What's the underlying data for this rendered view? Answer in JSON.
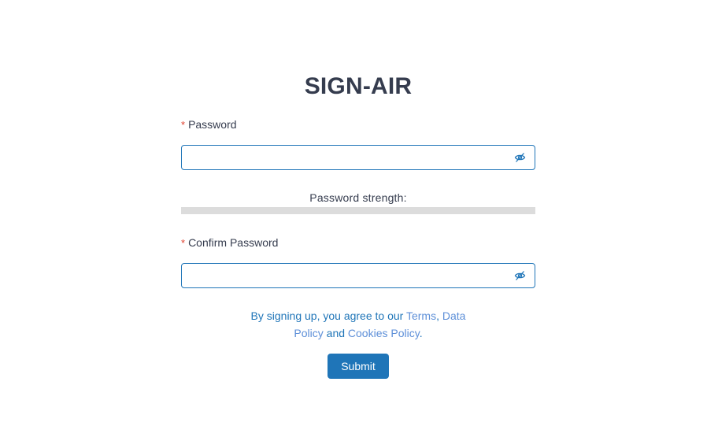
{
  "form": {
    "title": "SIGN-AIR",
    "required_mark": "*",
    "password": {
      "label": "Password",
      "value": "",
      "placeholder": ""
    },
    "strength": {
      "label": "Password strength:",
      "level": 0
    },
    "confirm": {
      "label": "Confirm Password",
      "value": "",
      "placeholder": ""
    },
    "terms": {
      "prefix": "By signing up, you agree to our ",
      "terms_link": "Terms",
      "sep": ", ",
      "data_policy_link": "Data Policy",
      "and": " and ",
      "cookies_link": "Cookies Policy",
      "suffix": "."
    },
    "submit_label": "Submit"
  },
  "icons": {
    "password_toggle": "eye-off-icon",
    "confirm_toggle": "eye-off-icon"
  },
  "colors": {
    "accent": "#1f75b8",
    "title": "#353c4e",
    "required": "#e0412f",
    "link": "#5d8fd8",
    "strength_track": "#dcdcdc"
  }
}
